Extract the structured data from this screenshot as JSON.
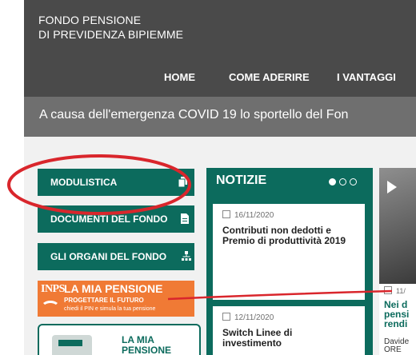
{
  "brand": {
    "line1": "FONDO PENSIONE",
    "line2": "DI PREVIDENZA BIPIEMME"
  },
  "nav": [
    {
      "label": "HOME"
    },
    {
      "label": "COME ADERIRE"
    },
    {
      "label": "I VANTAGGI"
    }
  ],
  "banner": {
    "text": "A causa dell'emergenza COVID 19 lo sportello del Fon"
  },
  "sidebar": {
    "buttons": [
      {
        "label": "MODULISTICA",
        "icon": "document-stack-icon"
      },
      {
        "label": "DOCUMENTI DEL FONDO",
        "icon": "document-icon"
      },
      {
        "label": "GLI ORGANI DEL FONDO",
        "icon": "org-chart-icon"
      }
    ],
    "inps": {
      "logo": "INPS",
      "title": "LA MIA PENSIONE",
      "subtitle": "PROGETTARE IL FUTURO",
      "note": "chiedi il PIN e simula la tua pensione"
    },
    "lamia": {
      "line1": "LA MIA",
      "line2": "PENSIONE"
    }
  },
  "news": {
    "title": "NOTIZIE",
    "items": [
      {
        "date": "16/11/2020",
        "title": "Contributi non dedotti e Premio di produttività 2019"
      },
      {
        "date": "12/11/2020",
        "title": "Switch Linee di investimento"
      }
    ]
  },
  "feature": {
    "date": "11/",
    "title": "Nei d\npensi\nrendi",
    "author": "Davide\nORE"
  },
  "colors": {
    "primary": "#0c6b5d",
    "header": "#4a4a4a",
    "banner": "#6f6f6f",
    "inps": "#f07a35",
    "annotation": "#d9262c"
  }
}
